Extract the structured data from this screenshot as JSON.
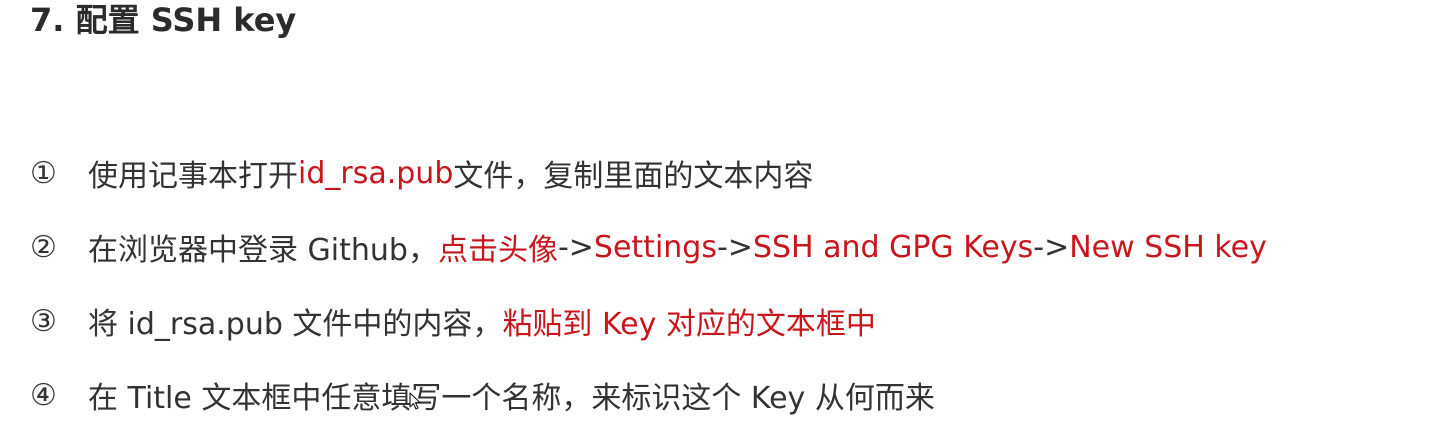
{
  "heading": "7. 配置 SSH key",
  "colors": {
    "text": "#333333",
    "accent": "#c8161d"
  },
  "steps": [
    {
      "marker": "①",
      "parts": [
        {
          "text": "使用记事本打开 ",
          "highlight": false
        },
        {
          "text": "id_rsa.pub",
          "highlight": true
        },
        {
          "text": " 文件，复制里面的文本内容",
          "highlight": false
        }
      ]
    },
    {
      "marker": "②",
      "parts": [
        {
          "text": "在浏览器中登录 Github，",
          "highlight": false
        },
        {
          "text": "点击头像",
          "highlight": true
        },
        {
          "text": " -> ",
          "highlight": false
        },
        {
          "text": "Settings",
          "highlight": true
        },
        {
          "text": " -> ",
          "highlight": false
        },
        {
          "text": "SSH and GPG Keys",
          "highlight": true
        },
        {
          "text": " -> ",
          "highlight": false
        },
        {
          "text": "New SSH key",
          "highlight": true
        }
      ]
    },
    {
      "marker": "③",
      "parts": [
        {
          "text": "将 id_rsa.pub 文件中的内容，",
          "highlight": false
        },
        {
          "text": "粘贴到 Key 对应的文本框中",
          "highlight": true
        }
      ]
    },
    {
      "marker": "④",
      "parts": [
        {
          "text": "在 Title 文本框中任意填写一个名称，来标识这个 Key 从何而来",
          "highlight": false
        }
      ]
    }
  ]
}
